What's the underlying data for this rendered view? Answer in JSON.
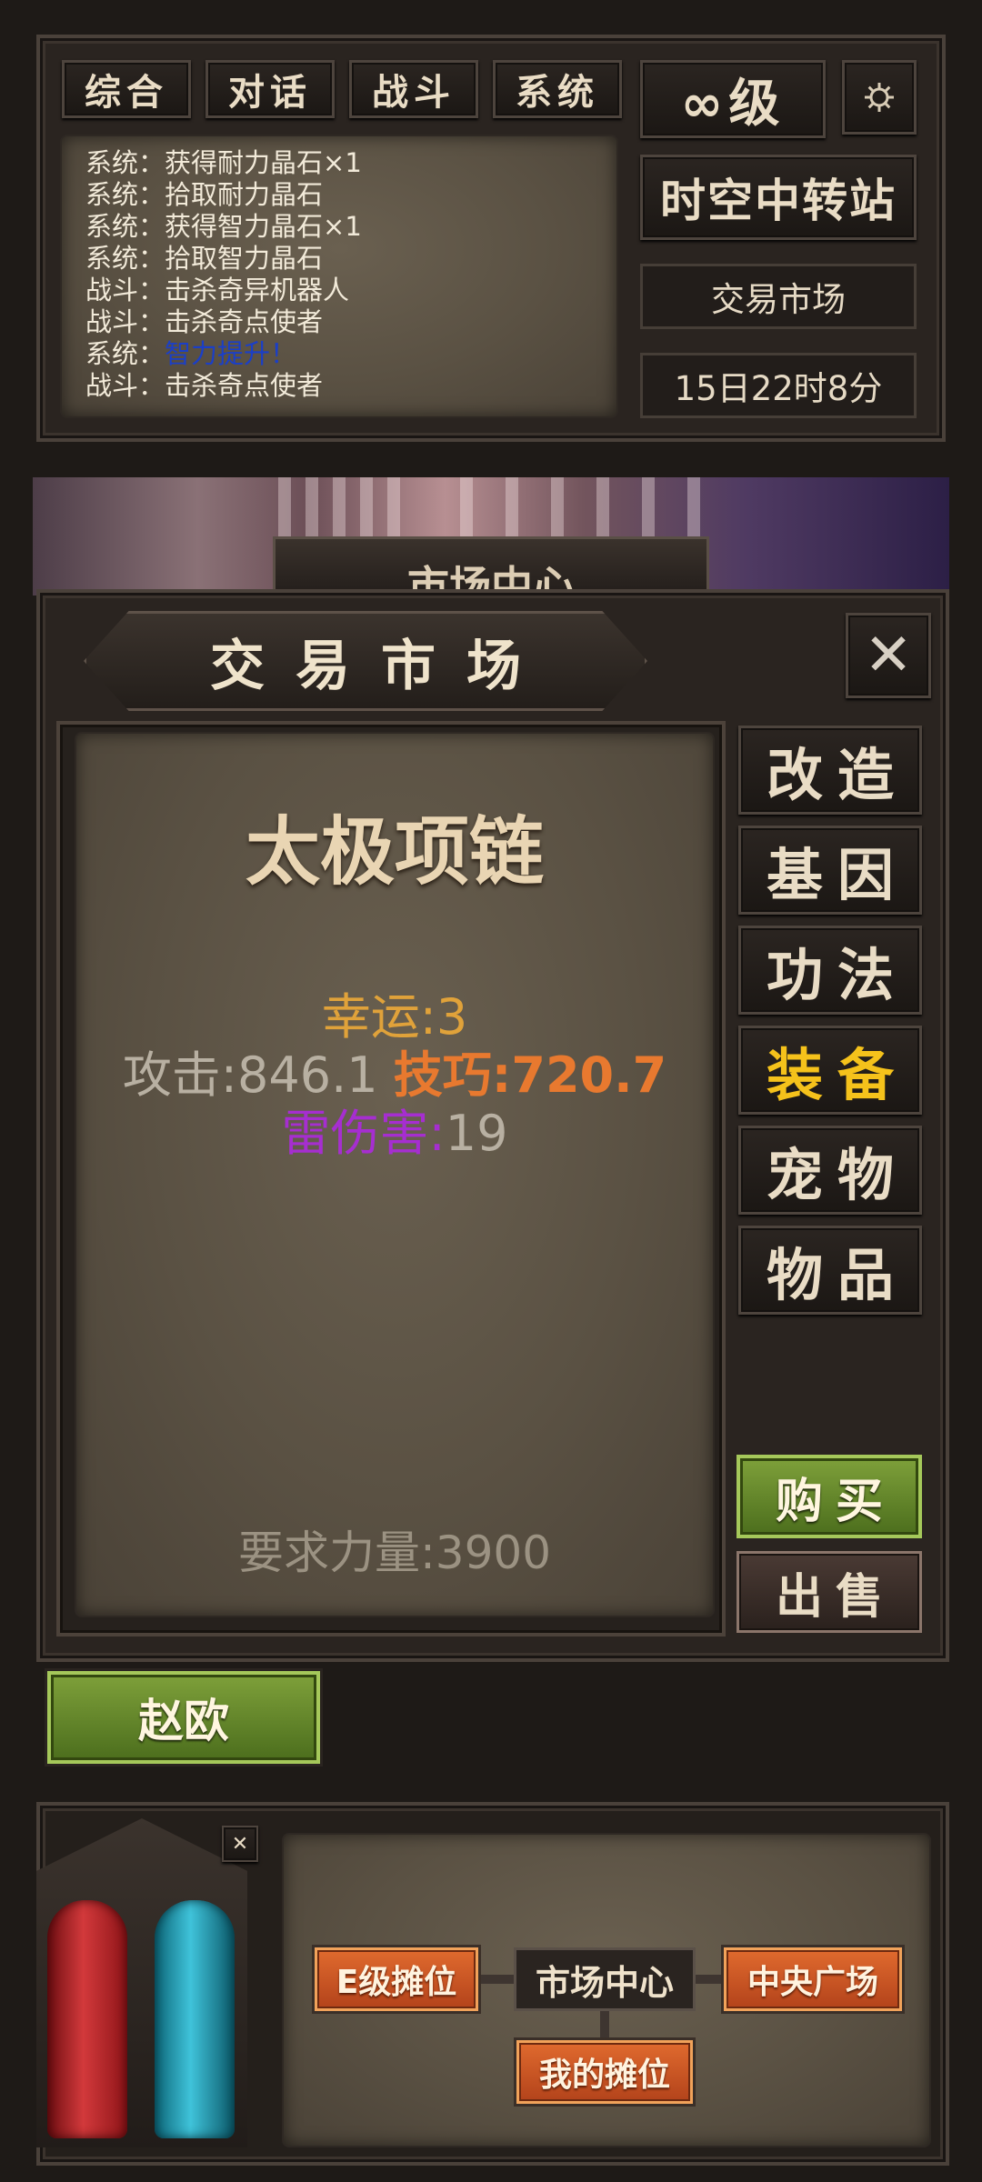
{
  "tabs": [
    "综合",
    "对话",
    "战斗",
    "系统"
  ],
  "chat": [
    {
      "prefix": "系统：",
      "text": "获得耐力晶石×1",
      "highlight": false
    },
    {
      "prefix": "系统：",
      "text": "拾取耐力晶石",
      "highlight": false
    },
    {
      "prefix": "系统：",
      "text": "获得智力晶石×1",
      "highlight": false
    },
    {
      "prefix": "系统：",
      "text": "拾取智力晶石",
      "highlight": false
    },
    {
      "prefix": "战斗：",
      "text": "击杀奇异机器人",
      "highlight": false
    },
    {
      "prefix": "战斗：",
      "text": "击杀奇点使者",
      "highlight": false
    },
    {
      "prefix": "系统：",
      "text": "智力提升！",
      "highlight": true
    },
    {
      "prefix": "战斗：",
      "text": "击杀奇点使者",
      "highlight": false
    }
  ],
  "header": {
    "level": "∞级",
    "gear_icon": "gear-icon",
    "station": "时空中转站",
    "location": "交易市场",
    "time": "15日22时8分"
  },
  "banner": {
    "title": "市场中心"
  },
  "dialog": {
    "title": "交易市场",
    "close_icon": "close-icon",
    "item": {
      "name": "太极项链",
      "luck": "幸运:3",
      "attack_label": "攻击:",
      "attack_value": "846.1",
      "skill": "技巧:720.7",
      "thunder_label": "雷伤害:",
      "thunder_value": "19",
      "requirement": "要求力量:3900"
    },
    "categories": [
      {
        "label": "改造",
        "active": false
      },
      {
        "label": "基因",
        "active": false
      },
      {
        "label": "功法",
        "active": false
      },
      {
        "label": "装备",
        "active": true
      },
      {
        "label": "宠物",
        "active": false
      },
      {
        "label": "物品",
        "active": false
      }
    ],
    "buy": "购买",
    "sell": "出售"
  },
  "player": {
    "name": "赵欧"
  },
  "bottom": {
    "stall_e": "E级摊位",
    "market_center": "市场中心",
    "central_square": "中央广场",
    "my_stall": "我的摊位"
  },
  "colors": {
    "luck": "#e0a23a",
    "attack": "#b8b0a2",
    "skill": "#e8792f",
    "thunder": "#a62ed0",
    "active_category": "#f5c21b",
    "chat_highlight": "#1b3fc7"
  }
}
